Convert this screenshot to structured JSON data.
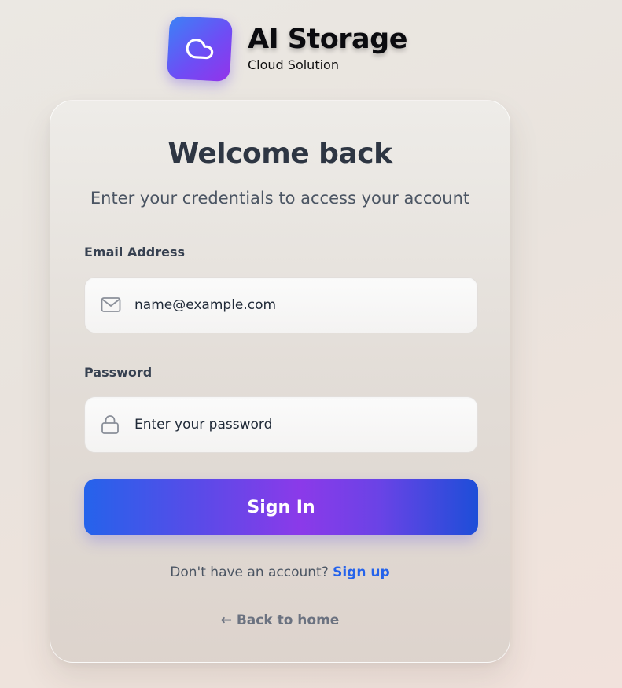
{
  "brand": {
    "title": "AI Storage",
    "subtitle": "Cloud Solution",
    "logo_icon": "cloud-icon",
    "logo_gradient": [
      "#3b82f6",
      "#9333ea"
    ]
  },
  "login": {
    "heading": "Welcome back",
    "subheading": "Enter your credentials to access your account",
    "email": {
      "label": "Email Address",
      "placeholder": "name@example.com",
      "value": "",
      "icon": "mail-icon"
    },
    "password": {
      "label": "Password",
      "placeholder": "Enter your password",
      "value": "",
      "icon": "lock-icon"
    },
    "submit_label": "Sign In",
    "signup_prompt": "Don't have an account?",
    "signup_link": "Sign up",
    "back_link": "← Back to home"
  },
  "colors": {
    "heading": "#2e3643",
    "link": "#2563eb",
    "button_gradient": [
      "#2563eb",
      "#8b3ae9",
      "#1d4ed8"
    ],
    "muted": "#6b7280"
  }
}
